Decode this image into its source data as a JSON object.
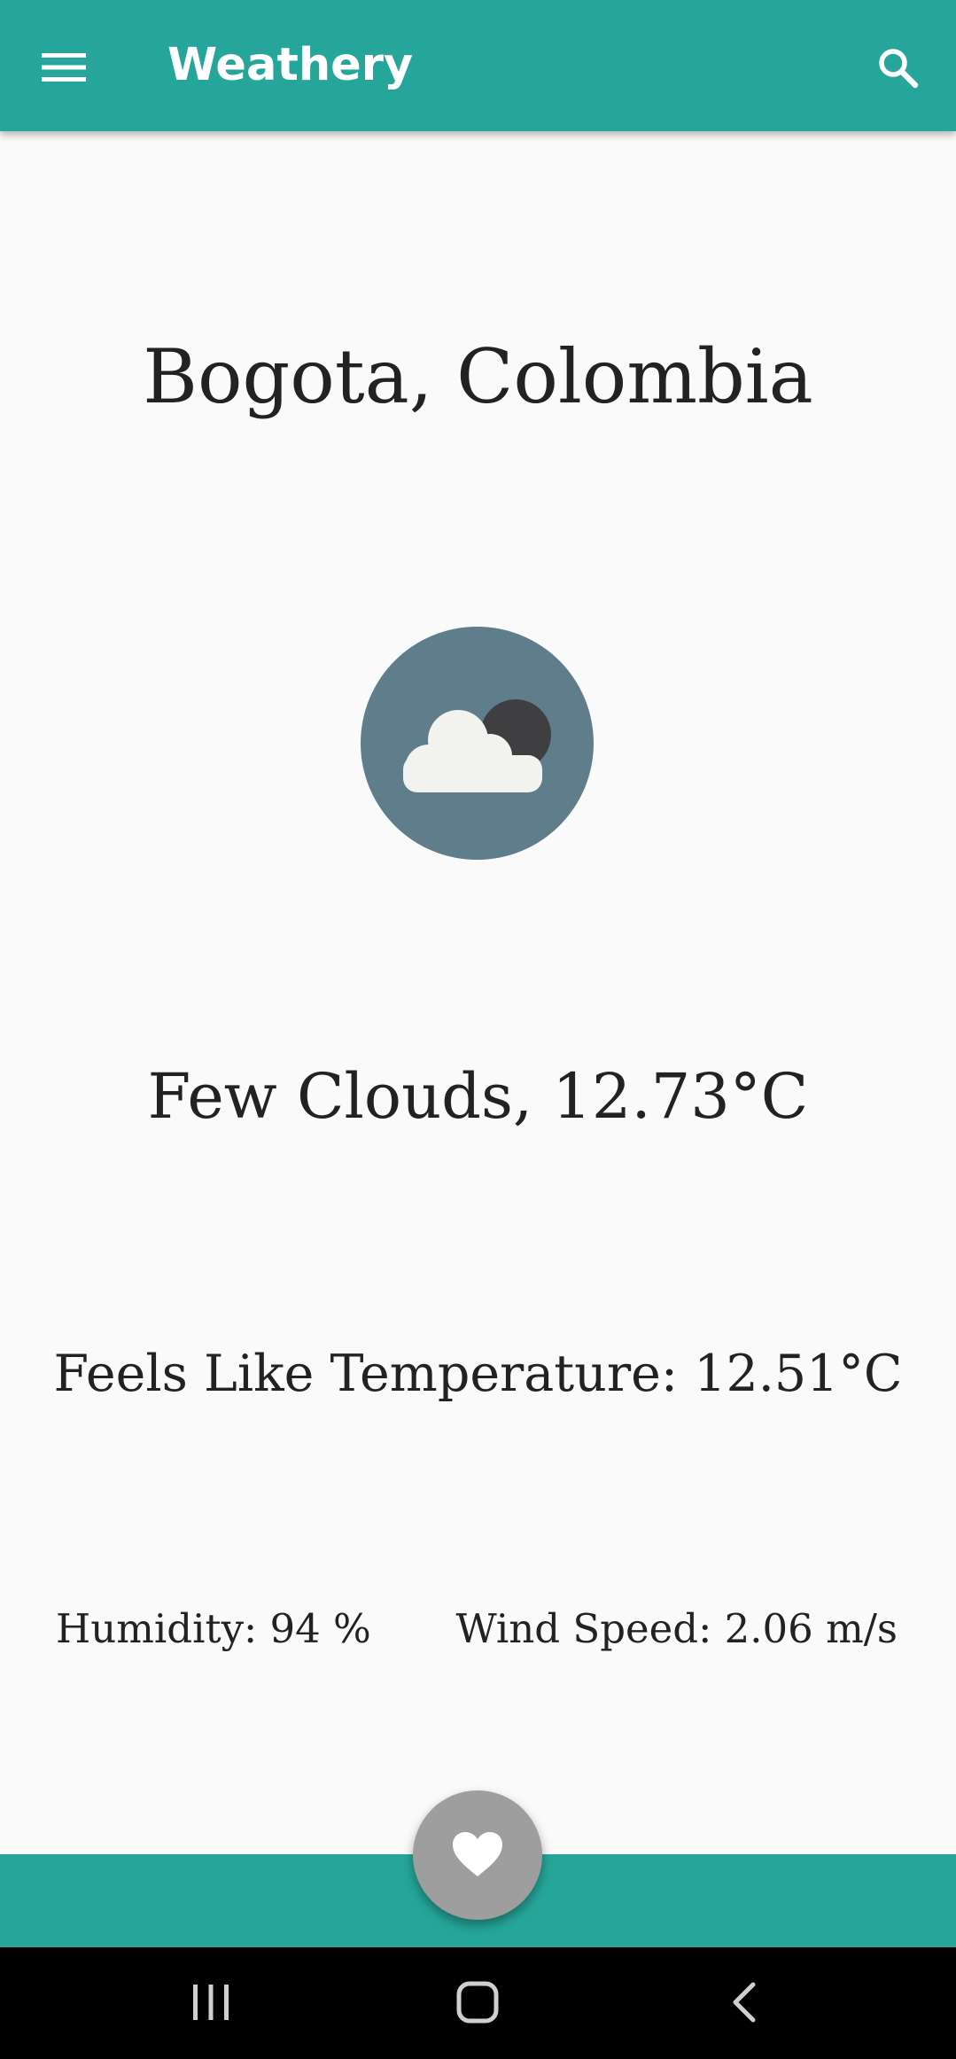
{
  "app": {
    "title": "Weathery",
    "accent_color": "#26a69a",
    "icons": {
      "menu": "menu-icon",
      "search": "search-icon",
      "weather": "few-clouds-night-icon",
      "favorite": "heart-icon"
    }
  },
  "weather": {
    "location": "Bogota, Colombia",
    "condition_line": "Few Clouds, 12.73°C",
    "feels_like_line": "Feels Like Temperature: 12.51°C",
    "humidity_line": "Humidity: 94 %",
    "wind_line": "Wind Speed: 2.06 m/s"
  },
  "system_nav": {
    "icons": [
      "recent-apps-icon",
      "home-icon",
      "back-icon"
    ]
  }
}
